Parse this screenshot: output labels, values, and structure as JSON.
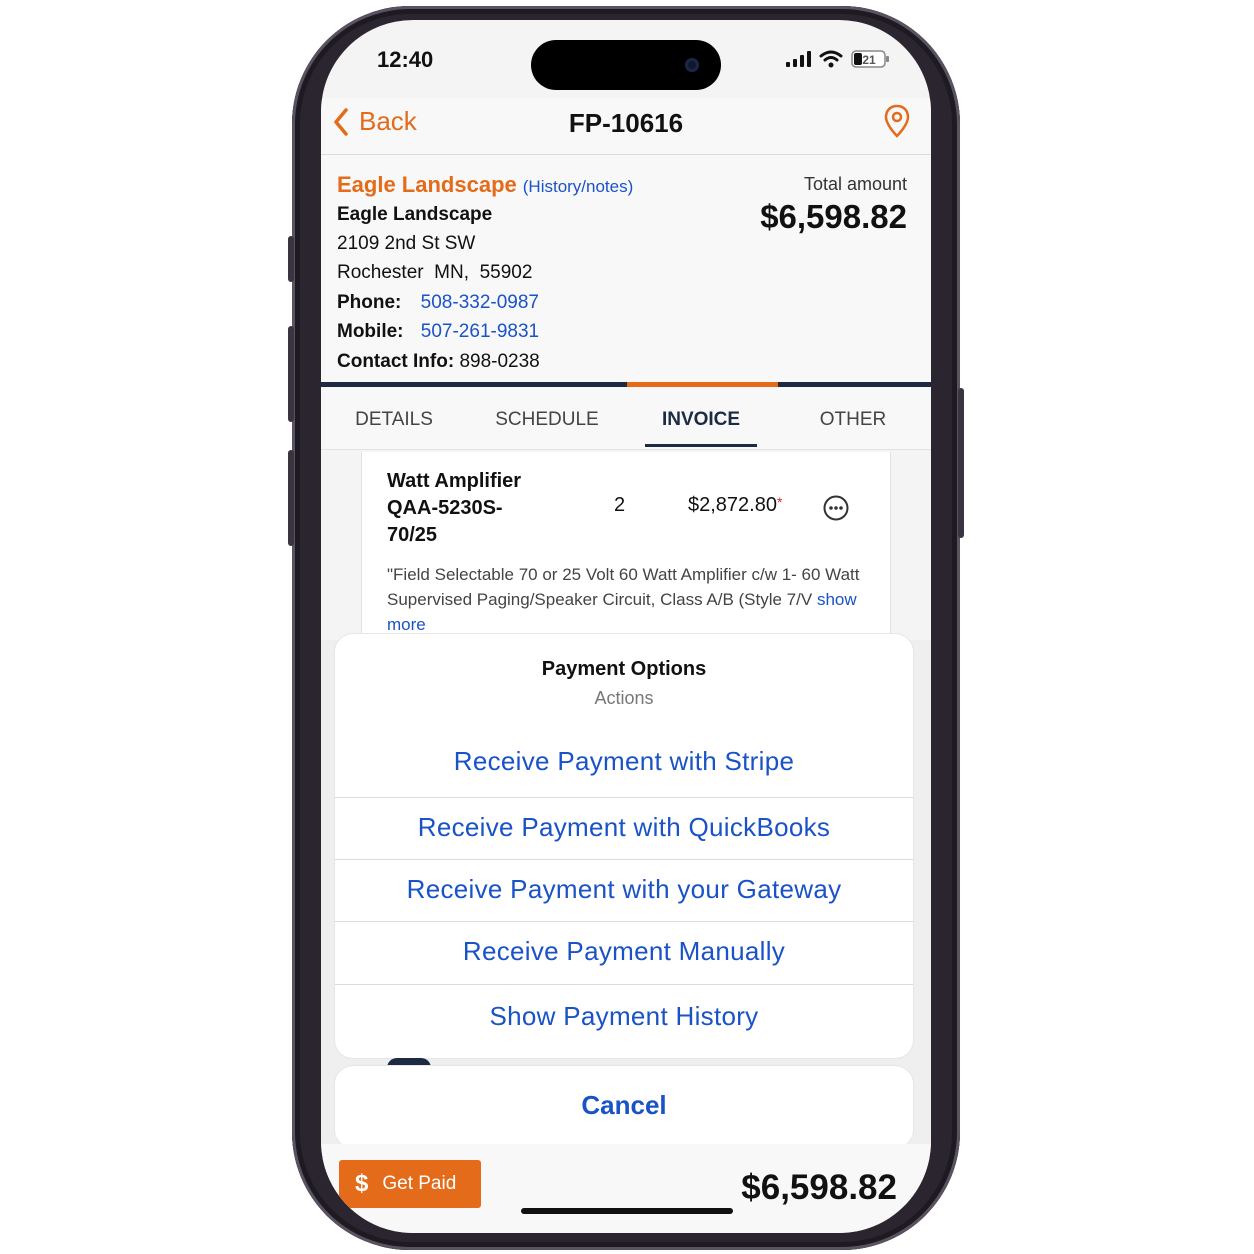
{
  "status_bar": {
    "time": "12:40",
    "battery": "21"
  },
  "nav": {
    "back_label": "Back",
    "title": "FP-10616"
  },
  "customer": {
    "company_link": "Eagle Landscape",
    "history_link": "(History/notes)",
    "name": "Eagle Landscape",
    "address1": "2109 2nd St SW",
    "city": "Rochester",
    "state": "MN,",
    "zip": "55902",
    "phone_label": "Phone:",
    "phone": "508-332-0987",
    "mobile_label": "Mobile:",
    "mobile": "507-261-9831",
    "contact_label": "Contact Info:",
    "contact": "898-0238",
    "total_label": "Total amount",
    "total": "$6,598.82"
  },
  "tabs": [
    {
      "label": "DETAILS"
    },
    {
      "label": "SCHEDULE"
    },
    {
      "label": "INVOICE"
    },
    {
      "label": "OTHER"
    }
  ],
  "item": {
    "name_line1": "Watt Amplifier",
    "name_line2": "QAA-5230S-",
    "name_line3": "70/25",
    "qty": "2",
    "price": "$2,872.80",
    "price_flag": "*",
    "description": "\"Field Selectable 70 or 25 Volt 60 Watt Amplifier c/w 1- 60 Watt Supervised Paging/Speaker Circuit, Class A/B (Style 7/V",
    "show_more": "show more"
  },
  "sheet": {
    "title": "Payment Options",
    "subtitle": "Actions",
    "options": [
      {
        "label": "Receive Payment with Stripe"
      },
      {
        "label": "Receive Payment with QuickBooks"
      },
      {
        "label": "Receive Payment with your Gateway"
      },
      {
        "label": "Receive Payment Manually"
      },
      {
        "label": "Show Payment History"
      }
    ],
    "cancel_label": "Cancel"
  },
  "bottom": {
    "get_paid_icon": "$",
    "get_paid_label": "Get Paid",
    "total": "$6,598.82"
  },
  "colors": {
    "accent": "#e36b1a",
    "link": "#1a52c7",
    "navy": "#1d2a44"
  }
}
